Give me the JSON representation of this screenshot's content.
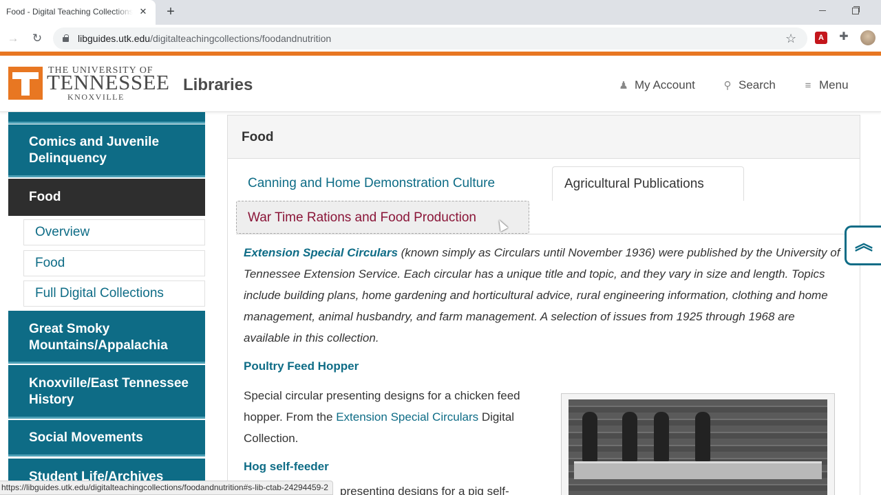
{
  "browser": {
    "tab_title": "Food - Digital Teaching Collections - LibGuides at University of Tennessee",
    "close_tab_glyph": "✕",
    "new_tab_glyph": "+",
    "url_host": "libguides.utk.edu",
    "url_path": "/digitaltreachingcollections/foodandnutrition",
    "url_path_display": "/digitalteachingcollections/foodandnutrition",
    "status_url": "https://libguides.utk.edu/digitalteachingcollections/foodandnutrition#s-lib-ctab-24294459-2",
    "icons": [
      "back-icon",
      "reload-icon",
      "lock-icon",
      "star-icon",
      "pdf-extension-icon",
      "puzzle-icon",
      "profile-icon"
    ]
  },
  "header": {
    "logo_line1": "THE UNIVERSITY OF",
    "logo_line2": "TENNESSEE",
    "logo_line3": "KNOXVILLE",
    "site_title": "Libraries",
    "nav": {
      "account": "My Account",
      "search": "Search",
      "menu": "Menu"
    }
  },
  "sidebar": {
    "items": [
      {
        "label": "Comics and Juvenile Delinquency"
      },
      {
        "label": "Food",
        "active": true
      },
      {
        "label": "Great Smoky Mountains/Appalachia"
      },
      {
        "label": "Knoxville/East Tennessee History"
      },
      {
        "label": "Social Movements"
      },
      {
        "label": "Student Life/Archives"
      }
    ],
    "subitems": [
      {
        "label": "Overview"
      },
      {
        "label": "Food"
      },
      {
        "label": "Full Digital Collections"
      }
    ]
  },
  "main": {
    "panel_title": "Food",
    "tabs": [
      {
        "label": "Canning and Home Demonstration Culture"
      },
      {
        "label": "Agricultural Publications",
        "selected": true
      },
      {
        "label": "War Time Rations and Food Production",
        "hover": true
      }
    ],
    "intro_link": "Extension Special Circulars",
    "intro_text": " (known simply as Circulars until November 1936) were published by the University of Tennessee Extension Service. Each circular has a unique title and topic, and they vary in size and length. Topics include building plans, home gardening and horticultural advice, rural engineering information, clothing and home management, animal husbandry, and farm management. A selection of issues from 1925 through 1968 are available in this collection.",
    "item1_title": "Poultry Feed Hopper",
    "item1_desc_a": "Special circular presenting designs for a chicken feed hopper. From the ",
    "item1_desc_link": "Extension Special Circulars",
    "item1_desc_b": " Digital Collection.",
    "item2_title": "Hog self-feeder",
    "item2_desc_partial": "presenting designs for a pig self-"
  },
  "back_to_top_glyph": "︽",
  "colors": {
    "ut_orange": "#e87722",
    "teal": "#0e6c86",
    "dark": "#2e2e2e",
    "tab_hover_text": "#8a1538"
  }
}
